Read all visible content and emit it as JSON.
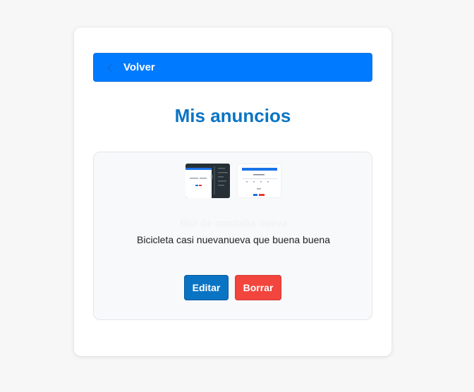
{
  "nav": {
    "back_label": "Volver",
    "back_icon": "arrow-left-icon"
  },
  "page": {
    "title": "Mis anuncios"
  },
  "ads": [
    {
      "title": "Bici de montaña nueva",
      "description": "Bicicleta casi nuevanueva que buena buena",
      "edit_label": "Editar",
      "delete_label": "Borrar",
      "images": [
        "screenshot-thumbnail-dark",
        "screenshot-thumbnail-light"
      ]
    }
  ],
  "colors": {
    "primary": "#007bff",
    "title": "#0a74c4",
    "edit": "#0a74c4",
    "delete": "#f2453d",
    "background": "#f7f7f7"
  }
}
